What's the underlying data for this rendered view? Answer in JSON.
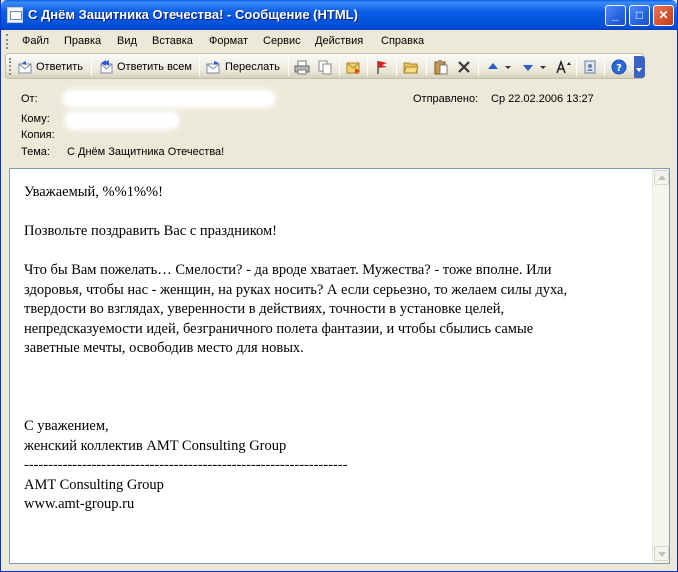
{
  "window": {
    "title": "С Днём Защитника Отечества! - Сообщение (HTML)",
    "minimize_glyph": "_",
    "maximize_glyph": "□",
    "close_glyph": "✕"
  },
  "menu": {
    "items": [
      "Файл",
      "Правка",
      "Вид",
      "Вставка",
      "Формат",
      "Сервис",
      "Действия",
      "Справка"
    ]
  },
  "toolbar": {
    "reply_label": "Ответить",
    "reply_all_label": "Ответить всем",
    "forward_label": "Переслать",
    "icons": [
      "reply-icon",
      "reply-all-icon",
      "forward-icon",
      "print-icon",
      "copy-icon",
      "move-to-folder-icon",
      "flag-icon",
      "open-folder-icon",
      "paste-icon",
      "delete-icon",
      "previous-item-icon",
      "next-item-icon",
      "font-size-icon",
      "address-book-icon",
      "help-icon"
    ],
    "colors": {
      "flag": "#d42020",
      "nav_arrow": "#2a5ad0",
      "help": "#2a6ad8"
    }
  },
  "header": {
    "from_label": "От:",
    "to_label": "Кому:",
    "cc_label": "Копия:",
    "subject_label": "Тема:",
    "subject_value": "С Днём Защитника Отечества!",
    "sent_label": "Отправлено:",
    "sent_value": "Ср 22.02.2006 13:27"
  },
  "message": {
    "greeting": "Уважаемый, %%1%%!",
    "line1": "Позвольте поздравить Вас с праздником!",
    "para_lines": [
      "Что бы Вам пожелать… Смелости? -  да вроде хватает. Мужества? -  тоже вполне. Или",
      "здоровья, чтобы нас - женщин, на руках носить? А если серьезно, то желаем силы духа,",
      "твердости во взглядах, уверенности в действиях, точности в установке целей,",
      "непредсказуемости идей, безграничного полета фантазии, и чтобы сбылись самые",
      "заветные мечты, освободив место для новых."
    ],
    "closing": "С уважением,",
    "signature": "женский коллектив AMT Consulting Group",
    "divider": "-------------------------------------------------------------------",
    "company": "AMT Consulting Group",
    "website": "www.amt-group.ru"
  }
}
